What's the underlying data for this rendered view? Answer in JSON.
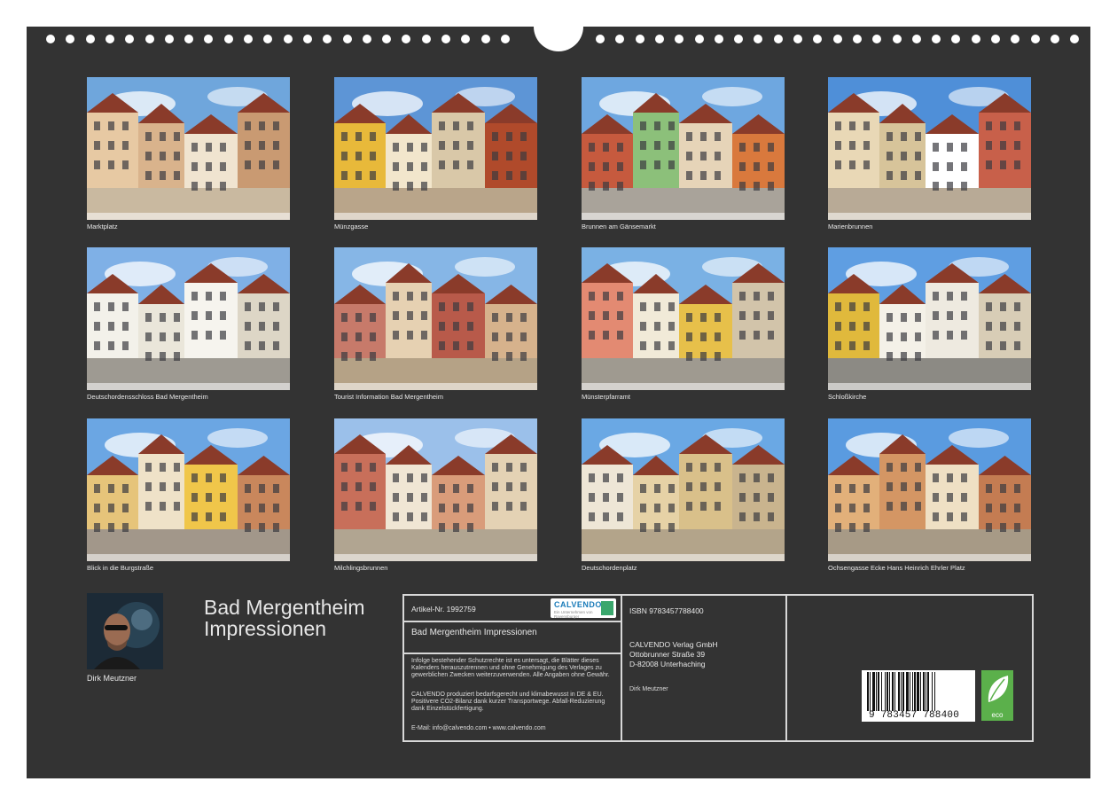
{
  "photos": [
    {
      "caption": "Marktplatz",
      "sky": "#6fa6dc",
      "ground": "#c9b9a0",
      "houses": [
        "#e7c9a3",
        "#d9b38c",
        "#f0e4d0",
        "#c99a72"
      ]
    },
    {
      "caption": "Münzgasse",
      "sky": "#5d95d6",
      "ground": "#b9a58a",
      "houses": [
        "#e8b93a",
        "#f2e6cc",
        "#d9c8a8",
        "#b04a2b"
      ]
    },
    {
      "caption": "Brunnen am Gänsemarkt",
      "sky": "#6ea7e0",
      "ground": "#a9a39a",
      "houses": [
        "#c65a3e",
        "#8cc07a",
        "#e6d4b8",
        "#d9793d"
      ]
    },
    {
      "caption": "Marienbrunnen",
      "sky": "#4f8fd8",
      "ground": "#b8aa96",
      "houses": [
        "#e9d8b6",
        "#d7c49a",
        "#ffffff",
        "#c8604a"
      ]
    },
    {
      "caption": "Deutschordensschloss Bad Mergentheim",
      "sky": "#7fb0e6",
      "ground": "#9e9a92",
      "houses": [
        "#f3f1ea",
        "#eae6da",
        "#f6f4ee",
        "#ddd6c6"
      ]
    },
    {
      "caption": "Tourist Information Bad Mergentheim",
      "sky": "#86b6e6",
      "ground": "#b5a286",
      "houses": [
        "#c77a6a",
        "#e6d1b2",
        "#b85a4a",
        "#d6b28c"
      ]
    },
    {
      "caption": "Münsterpfarramt",
      "sky": "#7ab1e4",
      "ground": "#9f9a90",
      "houses": [
        "#e38a72",
        "#f1ead8",
        "#e7c04a",
        "#d2c4aa"
      ]
    },
    {
      "caption": "Schloßkirche",
      "sky": "#5f9ee2",
      "ground": "#8c8a84",
      "houses": [
        "#e0b93c",
        "#f4f1e8",
        "#eeeae0",
        "#d8cdb6"
      ]
    },
    {
      "caption": "Blick in die Burgstraße",
      "sky": "#6ba6e3",
      "ground": "#a2978a",
      "houses": [
        "#e6c47a",
        "#efe2c8",
        "#f0c64a",
        "#c9875c"
      ]
    },
    {
      "caption": "Milchlingsbrunnen",
      "sky": "#9bc0ea",
      "ground": "#b1a591",
      "houses": [
        "#c86f5a",
        "#f0e6d4",
        "#d99c7a",
        "#e4d2b4"
      ]
    },
    {
      "caption": "Deutschordenplatz",
      "sky": "#6aa8e4",
      "ground": "#b3a48a",
      "houses": [
        "#eee6d6",
        "#e6d2a6",
        "#d9c08a",
        "#c9b48e"
      ]
    },
    {
      "caption": "Ochsengasse Ecke Hans Heinrich Ehrler Platz",
      "sky": "#5a9be0",
      "ground": "#a79a86",
      "houses": [
        "#e2b07a",
        "#d49664",
        "#efe0c4",
        "#c47c52"
      ]
    }
  ],
  "author": {
    "name": "Dirk Meutzner"
  },
  "title": {
    "line1": "Bad Mergentheim",
    "line2": "Impressionen"
  },
  "info": {
    "article": "Artikel-Nr. 1992759",
    "calendar_title": "Bad Mergentheim Impressionen",
    "legal": "Infolge bestehender Schutzrechte ist es untersagt, die Blätter dieses Kalenders herauszutrennen und ohne Genehmigung des Verlages zu gewerblichen Zwecken weiterzuverwenden. Alle Angaben ohne Gewähr.",
    "eco_note": "CALVENDO produziert bedarfsgerecht und klimabewusst in DE & EU. Positivere CO2-Bilanz dank kurzer Transportwege. Abfall-Reduzierung dank Einzelstückfertigung.",
    "contact": "E-Mail: info@calvendo.com • www.calvendo.com",
    "isbn": "ISBN 9783457788400",
    "publisher_name": "CALVENDO Verlag GmbH",
    "publisher_street": "Ottobrunner Straße 39",
    "publisher_city": "D-82008 Unterhaching",
    "author": "Dirk Meutzner",
    "logo_text": "CALVENDO",
    "logo_sub": "Ein Unternehmen von Ravensburger",
    "barcode_number": "9 783457 788400",
    "eco_label": "eco"
  },
  "colors": {
    "background": "#333333",
    "frame": "#d8d8d8",
    "eco_green": "#5bb04b",
    "brand_blue": "#1a7bb9"
  }
}
